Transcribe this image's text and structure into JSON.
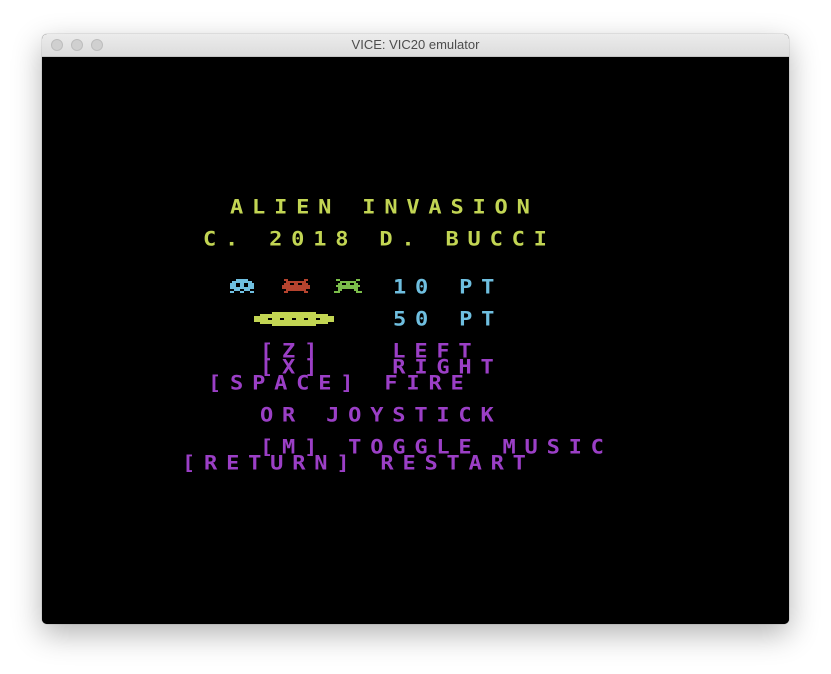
{
  "window": {
    "title": "VICE: VIC20 emulator"
  },
  "game": {
    "title": "ALIEN INVASION",
    "copyright": "C. 2018 D. BUCCI",
    "aliens_points": "10 PT",
    "saucer_points": "50 PT",
    "control_z": "[Z]   LEFT",
    "control_x": "[X]   RIGHT",
    "control_space": "[SPACE] FIRE",
    "joystick": "OR JOYSTICK",
    "control_m": "[M] TOGGLE MUSIC",
    "control_return": "[RETURN] RESTART"
  },
  "colors": {
    "title": "#c2d553",
    "points": "#6fbfe0",
    "controls": "#9b3fc6",
    "alien_cyan": "#6fbfe0",
    "alien_red": "#b5432e",
    "alien_green": "#7bbd4a",
    "saucer": "#c2d553"
  },
  "icons": [
    "alien-cyan-icon",
    "alien-red-icon",
    "alien-green-icon",
    "saucer-icon"
  ]
}
